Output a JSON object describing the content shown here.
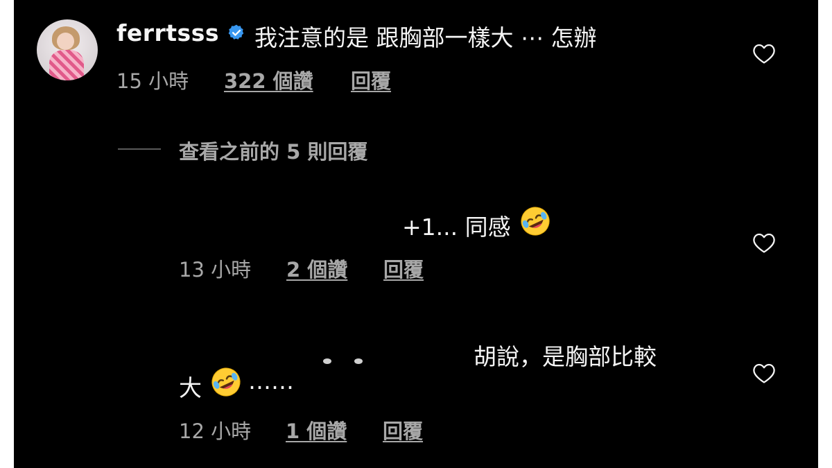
{
  "comment": {
    "username": "ferrtsss",
    "text": "我注意的是 跟胸部一樣大 ⋯ 怎辦",
    "time": "15 小時",
    "likes": "322 個讚",
    "reply_label": "回覆"
  },
  "view_previous": "查看之前的 5 則回覆",
  "replies": [
    {
      "text": "+1... 同感",
      "time": "13 小時",
      "likes": "2 個讚",
      "reply_label": "回覆"
    },
    {
      "text_line1": "胡說，是胸部比較",
      "text_line2_pre": "大",
      "text_line2_post": "……",
      "time": "12 小時",
      "likes": "1 個讚",
      "reply_label": "回覆"
    }
  ],
  "icons": {
    "verified": "verified-badge-icon",
    "like": "heart-outline-icon",
    "emoji": "rolling-on-floor-laughing-emoji"
  },
  "colors": {
    "background": "#000000",
    "text": "#f5f5f5",
    "meta": "#a8a8a8",
    "verified": "#3897f0"
  }
}
